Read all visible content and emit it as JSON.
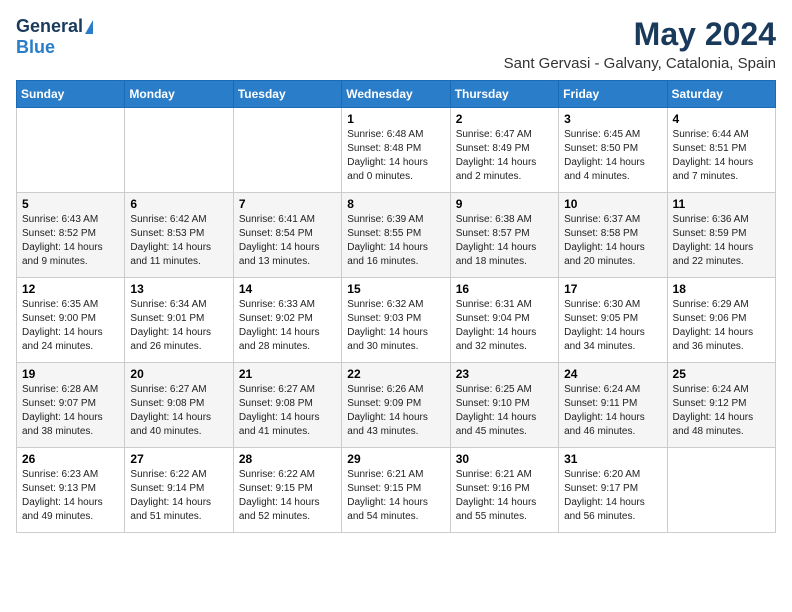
{
  "logo": {
    "general": "General",
    "blue": "Blue"
  },
  "title": "May 2024",
  "subtitle": "Sant Gervasi - Galvany, Catalonia, Spain",
  "days_header": [
    "Sunday",
    "Monday",
    "Tuesday",
    "Wednesday",
    "Thursday",
    "Friday",
    "Saturday"
  ],
  "weeks": [
    [
      {
        "day": "",
        "info": ""
      },
      {
        "day": "",
        "info": ""
      },
      {
        "day": "",
        "info": ""
      },
      {
        "day": "1",
        "info": "Sunrise: 6:48 AM\nSunset: 8:48 PM\nDaylight: 14 hours\nand 0 minutes."
      },
      {
        "day": "2",
        "info": "Sunrise: 6:47 AM\nSunset: 8:49 PM\nDaylight: 14 hours\nand 2 minutes."
      },
      {
        "day": "3",
        "info": "Sunrise: 6:45 AM\nSunset: 8:50 PM\nDaylight: 14 hours\nand 4 minutes."
      },
      {
        "day": "4",
        "info": "Sunrise: 6:44 AM\nSunset: 8:51 PM\nDaylight: 14 hours\nand 7 minutes."
      }
    ],
    [
      {
        "day": "5",
        "info": "Sunrise: 6:43 AM\nSunset: 8:52 PM\nDaylight: 14 hours\nand 9 minutes."
      },
      {
        "day": "6",
        "info": "Sunrise: 6:42 AM\nSunset: 8:53 PM\nDaylight: 14 hours\nand 11 minutes."
      },
      {
        "day": "7",
        "info": "Sunrise: 6:41 AM\nSunset: 8:54 PM\nDaylight: 14 hours\nand 13 minutes."
      },
      {
        "day": "8",
        "info": "Sunrise: 6:39 AM\nSunset: 8:55 PM\nDaylight: 14 hours\nand 16 minutes."
      },
      {
        "day": "9",
        "info": "Sunrise: 6:38 AM\nSunset: 8:57 PM\nDaylight: 14 hours\nand 18 minutes."
      },
      {
        "day": "10",
        "info": "Sunrise: 6:37 AM\nSunset: 8:58 PM\nDaylight: 14 hours\nand 20 minutes."
      },
      {
        "day": "11",
        "info": "Sunrise: 6:36 AM\nSunset: 8:59 PM\nDaylight: 14 hours\nand 22 minutes."
      }
    ],
    [
      {
        "day": "12",
        "info": "Sunrise: 6:35 AM\nSunset: 9:00 PM\nDaylight: 14 hours\nand 24 minutes."
      },
      {
        "day": "13",
        "info": "Sunrise: 6:34 AM\nSunset: 9:01 PM\nDaylight: 14 hours\nand 26 minutes."
      },
      {
        "day": "14",
        "info": "Sunrise: 6:33 AM\nSunset: 9:02 PM\nDaylight: 14 hours\nand 28 minutes."
      },
      {
        "day": "15",
        "info": "Sunrise: 6:32 AM\nSunset: 9:03 PM\nDaylight: 14 hours\nand 30 minutes."
      },
      {
        "day": "16",
        "info": "Sunrise: 6:31 AM\nSunset: 9:04 PM\nDaylight: 14 hours\nand 32 minutes."
      },
      {
        "day": "17",
        "info": "Sunrise: 6:30 AM\nSunset: 9:05 PM\nDaylight: 14 hours\nand 34 minutes."
      },
      {
        "day": "18",
        "info": "Sunrise: 6:29 AM\nSunset: 9:06 PM\nDaylight: 14 hours\nand 36 minutes."
      }
    ],
    [
      {
        "day": "19",
        "info": "Sunrise: 6:28 AM\nSunset: 9:07 PM\nDaylight: 14 hours\nand 38 minutes."
      },
      {
        "day": "20",
        "info": "Sunrise: 6:27 AM\nSunset: 9:08 PM\nDaylight: 14 hours\nand 40 minutes."
      },
      {
        "day": "21",
        "info": "Sunrise: 6:27 AM\nSunset: 9:08 PM\nDaylight: 14 hours\nand 41 minutes."
      },
      {
        "day": "22",
        "info": "Sunrise: 6:26 AM\nSunset: 9:09 PM\nDaylight: 14 hours\nand 43 minutes."
      },
      {
        "day": "23",
        "info": "Sunrise: 6:25 AM\nSunset: 9:10 PM\nDaylight: 14 hours\nand 45 minutes."
      },
      {
        "day": "24",
        "info": "Sunrise: 6:24 AM\nSunset: 9:11 PM\nDaylight: 14 hours\nand 46 minutes."
      },
      {
        "day": "25",
        "info": "Sunrise: 6:24 AM\nSunset: 9:12 PM\nDaylight: 14 hours\nand 48 minutes."
      }
    ],
    [
      {
        "day": "26",
        "info": "Sunrise: 6:23 AM\nSunset: 9:13 PM\nDaylight: 14 hours\nand 49 minutes."
      },
      {
        "day": "27",
        "info": "Sunrise: 6:22 AM\nSunset: 9:14 PM\nDaylight: 14 hours\nand 51 minutes."
      },
      {
        "day": "28",
        "info": "Sunrise: 6:22 AM\nSunset: 9:15 PM\nDaylight: 14 hours\nand 52 minutes."
      },
      {
        "day": "29",
        "info": "Sunrise: 6:21 AM\nSunset: 9:15 PM\nDaylight: 14 hours\nand 54 minutes."
      },
      {
        "day": "30",
        "info": "Sunrise: 6:21 AM\nSunset: 9:16 PM\nDaylight: 14 hours\nand 55 minutes."
      },
      {
        "day": "31",
        "info": "Sunrise: 6:20 AM\nSunset: 9:17 PM\nDaylight: 14 hours\nand 56 minutes."
      },
      {
        "day": "",
        "info": ""
      }
    ]
  ]
}
